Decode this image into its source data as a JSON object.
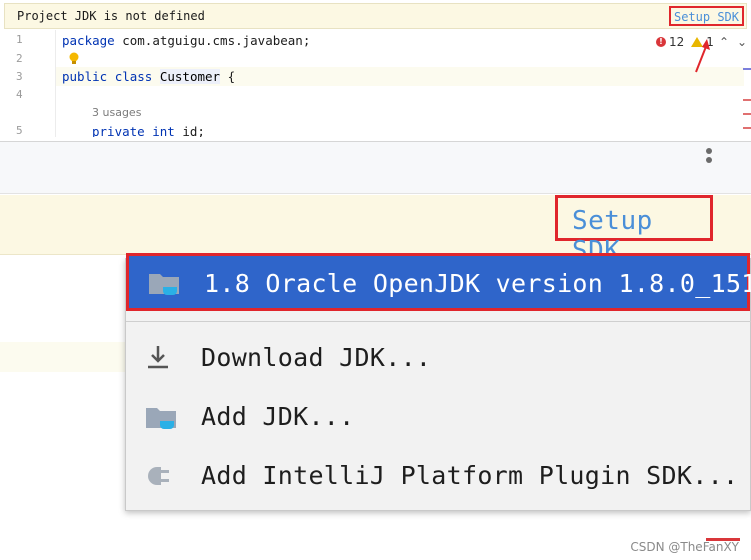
{
  "editor": {
    "banner_message": "Project JDK is not defined",
    "setup_sdk_label": "Setup SDK",
    "line_numbers": [
      "1",
      "2",
      "3",
      "4",
      "5"
    ],
    "code": {
      "line1_keyword": "package",
      "line1_rest": " com.atguigu.cms.javabean;",
      "line3_kw1": "public",
      "line3_kw2": "class",
      "line3_class": "Customer",
      "line3_brace": " {",
      "usages": "3 usages",
      "line5_kw1": "private",
      "line5_kw2": "int",
      "line5_rest": " id;"
    },
    "inspection": {
      "error_count": "12",
      "warning_count": "1",
      "error_color": "#d9363a",
      "warning_color": "#e8b600"
    }
  },
  "zoom": {
    "setup_sdk_label": "Setup SDK",
    "menu": {
      "items": [
        {
          "label": "1.8 Oracle OpenJDK version 1.8.0_151",
          "icon": "jdk-folder-icon",
          "selected": true
        },
        {
          "label": "Download JDK...",
          "icon": "download-icon",
          "selected": false
        },
        {
          "label": "Add JDK...",
          "icon": "add-jdk-folder-icon",
          "selected": false
        },
        {
          "label": "Add IntelliJ Platform Plugin SDK...",
          "icon": "plugin-plug-icon",
          "selected": false
        }
      ]
    }
  },
  "colors": {
    "selection": "#2f65ca",
    "highlight_frame": "#e0262c",
    "link": "#4a8fd8",
    "banner_bg": "#fcf8e3"
  },
  "watermark": "CSDN @TheFanXY"
}
